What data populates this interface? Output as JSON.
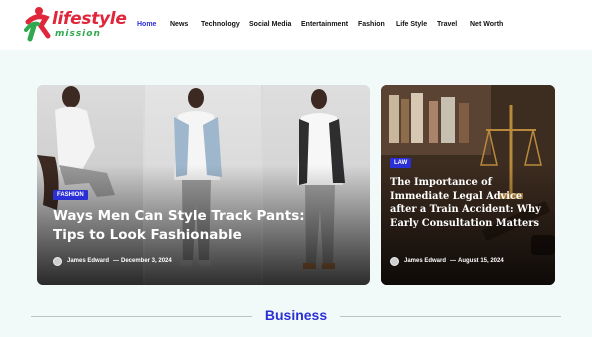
{
  "brand": {
    "name_line1": "lifestyle",
    "name_line2": "mission"
  },
  "nav": {
    "items": [
      "Home",
      "News",
      "Technology",
      "Social Media",
      "Entertainment",
      "Fashion",
      "Life Style",
      "Travel",
      "Net Worth"
    ],
    "active": "Home"
  },
  "featured": {
    "category": "FASHION",
    "title": "Ways Men Can Style Track Pants: Tips to Look Fashionable",
    "author": "James Edward",
    "date": "December 3, 2024"
  },
  "side": {
    "category": "LAW",
    "title": "The Importance of Immediate Legal Advice after a Train Accident: Why Early Consultation Matters",
    "author": "James Edward",
    "date": "August 15, 2024"
  },
  "section": {
    "title": "Business"
  },
  "colors": {
    "accent": "#2b2fd6",
    "brand_red": "#e0263a",
    "brand_green": "#2fa84f",
    "background": "#f2faf9"
  }
}
